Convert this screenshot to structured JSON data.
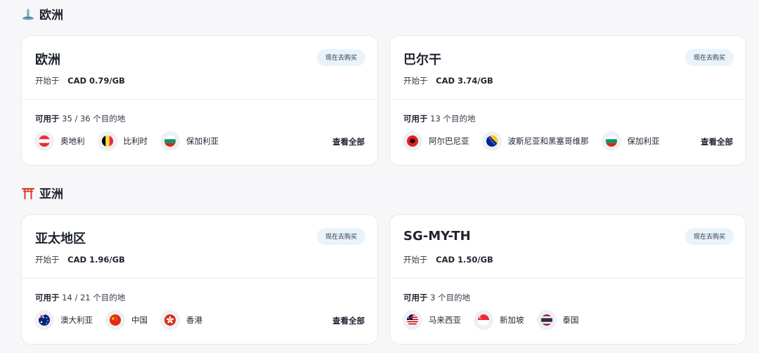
{
  "sections": [
    {
      "title": "欧洲",
      "cards": [
        {
          "name": "欧洲",
          "buy_label": "现在去购买",
          "price_label": "开始于",
          "price": "CAD 0.79/GB",
          "avail_label": "可用于",
          "avail_count": "35 / 36",
          "avail_suffix": "个目的地",
          "countries": [
            {
              "name": "奥地利",
              "flag": "austria"
            },
            {
              "name": "比利时",
              "flag": "belgium"
            },
            {
              "name": "保加利亚",
              "flag": "bulgaria"
            }
          ],
          "view_all": "查看全部"
        },
        {
          "name": "巴尔干",
          "buy_label": "现在去购买",
          "price_label": "开始于",
          "price": "CAD 3.74/GB",
          "avail_label": "可用于",
          "avail_count": "13",
          "avail_suffix": "个目的地",
          "countries": [
            {
              "name": "阿尔巴尼亚",
              "flag": "albania"
            },
            {
              "name": "波斯尼亚和黑塞哥维那",
              "flag": "bosnia"
            },
            {
              "name": "保加利亚",
              "flag": "bulgaria"
            }
          ],
          "view_all": "查看全部"
        }
      ]
    },
    {
      "title": "亚洲",
      "cards": [
        {
          "name": "亚太地区",
          "buy_label": "现在去购买",
          "price_label": "开始于",
          "price": "CAD 1.96/GB",
          "avail_label": "可用于",
          "avail_count": "14 / 21",
          "avail_suffix": "个目的地",
          "countries": [
            {
              "name": "澳大利亚",
              "flag": "australia"
            },
            {
              "name": "中国",
              "flag": "china"
            },
            {
              "name": "香港",
              "flag": "hongkong"
            }
          ],
          "view_all": "查看全部"
        },
        {
          "name": "SG-MY-TH",
          "buy_label": "现在去购买",
          "price_label": "开始于",
          "price": "CAD 1.50/GB",
          "avail_label": "可用于",
          "avail_count": "3",
          "avail_suffix": "个目的地",
          "countries": [
            {
              "name": "马来西亚",
              "flag": "malaysia"
            },
            {
              "name": "新加坡",
              "flag": "singapore"
            },
            {
              "name": "泰国",
              "flag": "thailand"
            }
          ]
        }
      ]
    }
  ]
}
